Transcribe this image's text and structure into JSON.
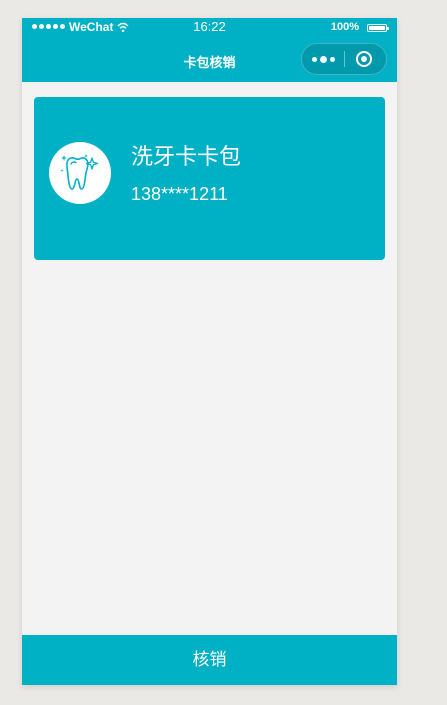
{
  "status_bar": {
    "carrier": "WeChat",
    "time": "16:22",
    "battery_percent": "100%",
    "icons": [
      "signal-dots-icon",
      "wifi-icon",
      "battery-icon"
    ]
  },
  "nav": {
    "title": "卡包核销",
    "capsule_icons": [
      "more-icon",
      "close-miniprogram-icon"
    ]
  },
  "card": {
    "name": "洗牙卡卡包",
    "phone": "138****1211",
    "icon": "tooth-sparkle-icon"
  },
  "footer": {
    "redeem_label": "核销"
  },
  "colors": {
    "accent": "#00b0c4",
    "background": "#f3f3f3",
    "card_text": "#ffffff"
  }
}
